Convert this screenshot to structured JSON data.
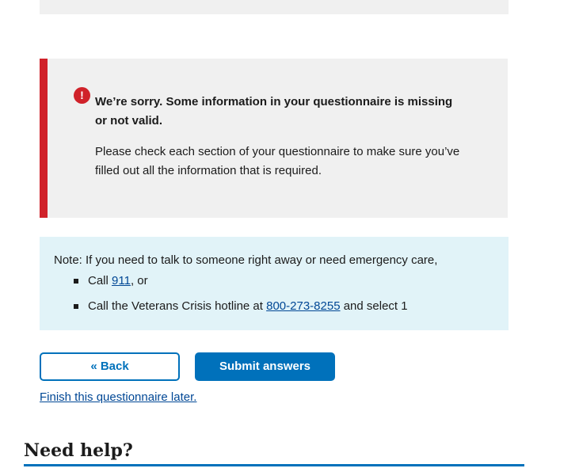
{
  "error_alert": {
    "icon": "exclamation-circle-icon",
    "icon_glyph": "!",
    "heading": "We’re sorry. Some information in your questionnaire is missing or not valid.",
    "body": "Please check each section of your questionnaire to make sure you’ve filled out all the information that is required."
  },
  "note": {
    "intro": "Note: If you need to talk to someone right away or need emergency care,",
    "item1": {
      "prefix": "Call ",
      "link": "911",
      "suffix": ", or"
    },
    "item2": {
      "prefix": "Call the Veterans Crisis hotline at ",
      "link": "800-273-8255",
      "suffix": " and select 1"
    }
  },
  "actions": {
    "back_label": "« Back",
    "submit_label": "Submit answers",
    "finish_later_label": "Finish this questionnaire later."
  },
  "help": {
    "heading": "Need help?"
  },
  "colors": {
    "error_accent": "#d0222a",
    "primary": "#0071bb",
    "link": "#004795",
    "info_background": "#e1f3f8",
    "alert_background": "#f0f0f0"
  }
}
